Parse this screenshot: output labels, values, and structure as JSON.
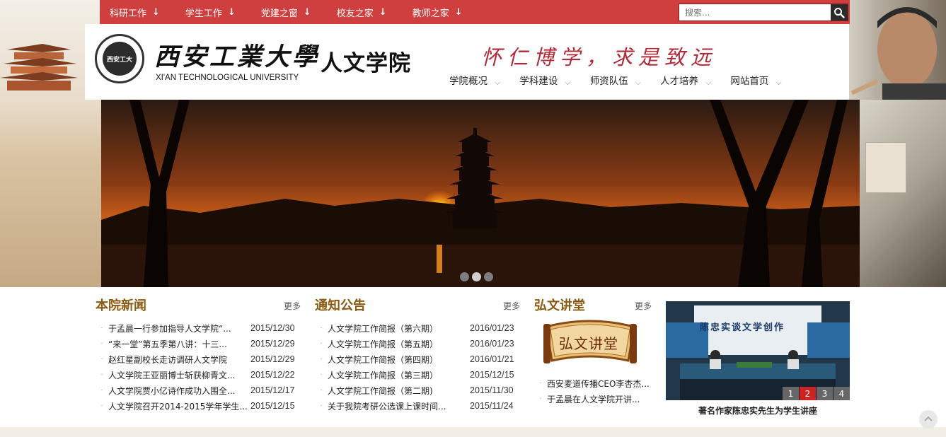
{
  "topnav": {
    "items": [
      {
        "label": "科研工作"
      },
      {
        "label": "学生工作"
      },
      {
        "label": "党建之窗"
      },
      {
        "label": "校友之家"
      },
      {
        "label": "教师之家"
      }
    ],
    "arrow_glyph": "↓"
  },
  "search": {
    "placeholder": "搜索..."
  },
  "header": {
    "seal_text": "西安工大",
    "university_cn": "西安工業大學",
    "university_en": "XI'AN TECHNOLOGICAL UNIVERSITY",
    "college": "人文学院",
    "motto": "怀仁博学，求是致远"
  },
  "mainnav": {
    "items": [
      {
        "label": "学院概况"
      },
      {
        "label": "学科建设"
      },
      {
        "label": "师资队伍"
      },
      {
        "label": "人才培养"
      },
      {
        "label": "网站首页"
      }
    ],
    "chev_glyph": "⌵"
  },
  "banner": {
    "dots": [
      {
        "color": "#7d7d7d"
      },
      {
        "color": "#cfcfcf"
      },
      {
        "color": "#7d7d7d"
      }
    ]
  },
  "news": {
    "title": "本院新闻",
    "more": "更多",
    "items": [
      {
        "text": "于孟晨一行参加指导人文学院“...",
        "date": "2015/12/30"
      },
      {
        "text": "“来一堂”第五季第八讲：十三...",
        "date": "2015/12/29"
      },
      {
        "text": "赵红星副校长走访调研人文学院",
        "date": "2015/12/29"
      },
      {
        "text": "人文学院王亚丽博士斩获柳青文...",
        "date": "2015/12/22"
      },
      {
        "text": "人文学院贾小亿诗作成功入围全...",
        "date": "2015/12/17"
      },
      {
        "text": "人文学院召开2014-2015学年学生...",
        "date": "2015/12/15"
      }
    ]
  },
  "notices": {
    "title": "通知公告",
    "more": "更多",
    "items": [
      {
        "text": "人文学院工作简报（第六期）",
        "date": "2016/01/23"
      },
      {
        "text": "人文学院工作简报（第五期）",
        "date": "2016/01/23"
      },
      {
        "text": "人文学院工作简报（第四期）",
        "date": "2016/01/21"
      },
      {
        "text": "人文学院工作简报（第三期）",
        "date": "2015/12/15"
      },
      {
        "text": "人文学院工作简报（第二期)",
        "date": "2015/11/30"
      },
      {
        "text": "关于我院考研公选课上课时间...",
        "date": "2015/11/24"
      }
    ]
  },
  "hongwen": {
    "title": "弘文讲堂",
    "more": "更多",
    "logo_text": "弘文讲堂",
    "items": [
      {
        "text": "西安麦道传播CEO李杏杰..."
      },
      {
        "text": "于孟晨在人文学院开讲..."
      }
    ]
  },
  "photo": {
    "banner_text": "陈忠实谈文学创作",
    "pages": [
      "1",
      "2",
      "3",
      "4"
    ],
    "active_page": "2",
    "caption": "著名作家陈忠实先生为学生讲座"
  },
  "colors": {
    "topbar": "#cf3f3f",
    "section_title": "#8a5a12",
    "motto": "#b12a3a",
    "active_page": "#cc2222"
  }
}
